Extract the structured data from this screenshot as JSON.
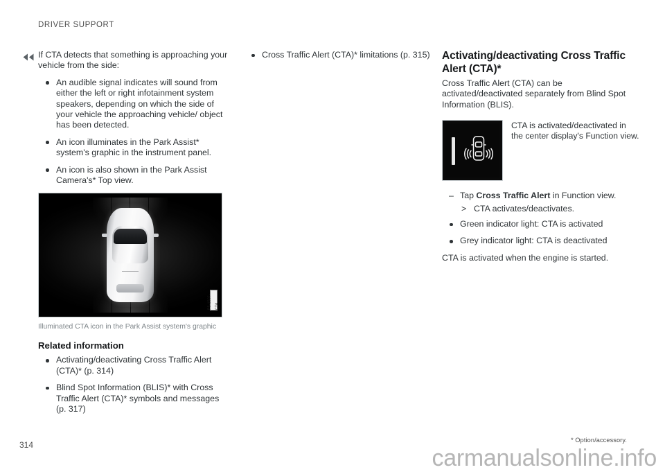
{
  "header": {
    "running_title": "DRIVER SUPPORT"
  },
  "markers": {
    "prev_icon": "double-left-arrow-icon"
  },
  "column_left": {
    "intro": "If CTA detects that something is approaching your vehicle from the side:",
    "bullets": [
      "An audible signal indicates will sound from either the left or right infotainment system speakers, depending on which the side of your vehicle the approaching vehicle/ object has been detected.",
      "An icon illuminates in the Park Assist* system's graphic in the instrument panel.",
      "An icon is also shown in the Park Assist Camera's* Top view."
    ],
    "figure": {
      "alt_name": "park-assist-top-view-graphic",
      "id_label": "P5-1507-CTA",
      "caption": "Illuminated CTA icon in the Park Assist system's graphic"
    },
    "related_information": {
      "title": "Related information",
      "links": [
        "Activating/deactivating Cross Traffic Alert (CTA)* (p. 314)",
        "Blind Spot Information (BLIS)* with Cross Traffic Alert (CTA)* symbols and messages (p. 317)"
      ]
    }
  },
  "column_middle": {
    "links": [
      "Cross Traffic Alert (CTA)* limitations (p. 315)"
    ]
  },
  "column_right": {
    "section_title": "Activating/deactivating Cross Traffic Alert (CTA)*",
    "intro": "Cross Traffic Alert (CTA) can be activated/deactivated separately from Blind Spot Information (BLIS).",
    "figure": {
      "alt_name": "cta-function-view-icon",
      "note": "CTA is activated/deactivated in the center display's Function view."
    },
    "steps": [
      {
        "prefix": "Tap ",
        "bold": "Cross Traffic Alert",
        "suffix": " in Function view.",
        "result": "CTA activates/deactivates."
      }
    ],
    "bullets": [
      "Green indicator light: CTA is activated",
      "Grey indicator light: CTA is deactivated"
    ],
    "closing": "CTA is activated when the engine is started."
  },
  "footer": {
    "page_number": "314",
    "footnote": "* Option/accessory.",
    "watermark": "carmanualsonline.info"
  },
  "colors": {
    "text": "#2f3437",
    "heading": "#17191b",
    "muted": "#7f868a",
    "rule": "#c9cfd2",
    "watermark": "#b5b5b5"
  }
}
